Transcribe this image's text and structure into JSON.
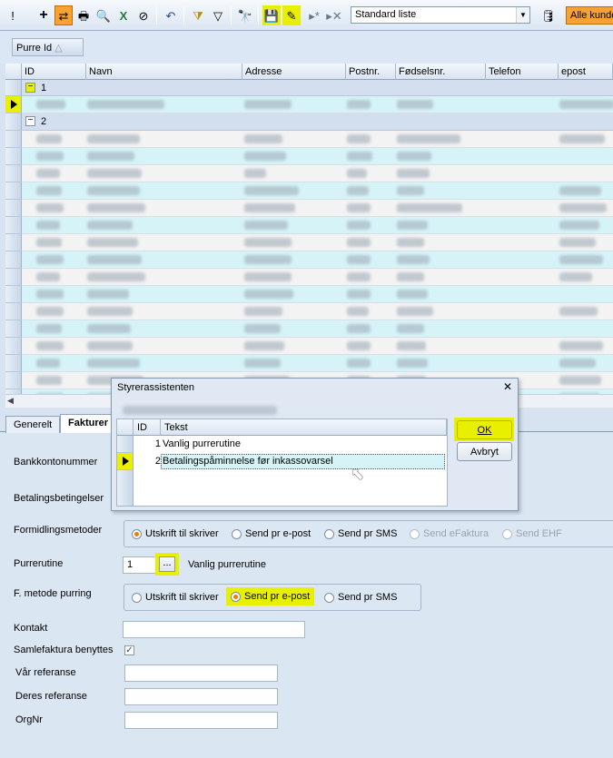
{
  "toolbar": {
    "list_select_value": "Standard liste",
    "alle_kunder_label": "Alle kunde"
  },
  "group_by": {
    "chip_label": "Purre Id"
  },
  "grid": {
    "columns": [
      "ID",
      "Navn",
      "Adresse",
      "Postnr.",
      "Fødselsnr.",
      "Telefon",
      "epost"
    ],
    "groups": [
      {
        "label": "1"
      },
      {
        "label": "2"
      }
    ]
  },
  "tabs": [
    "Generelt",
    "Fakturer"
  ],
  "form": {
    "bankkontonummer_label": "Bankkontonummer",
    "betalingsbetingelser_label": "Betalingsbetingelser",
    "formidlingsmetoder_label": "Formidlingsmetoder",
    "formidlingsmetoder_options": [
      "Utskrift til skriver",
      "Send pr e-post",
      "Send pr SMS",
      "Send eFaktura",
      "Send EHF"
    ],
    "purrerutine_label": "Purrerutine",
    "purrerutine_value": "1",
    "purrerutine_button": "...",
    "purrerutine_name": "Vanlig purrerutine",
    "fmetode_label": "F. metode purring",
    "fmetode_options": [
      "Utskrift til skriver",
      "Send pr e-post",
      "Send pr SMS"
    ],
    "kontakt_label": "Kontakt",
    "samlefaktura_label": "Samlefaktura benyttes",
    "samlefaktura_checked": "✓",
    "var_referanse_label": "Vår referanse",
    "deres_referanse_label": "Deres referanse",
    "orgnr_label": "OrgNr"
  },
  "dialog": {
    "title": "Styrerassistenten",
    "close": "✕",
    "columns": [
      "ID",
      "Tekst"
    ],
    "rows": [
      {
        "id": "1",
        "tekst": "Vanlig purrerutine"
      },
      {
        "id": "2",
        "tekst": "Betalingspåminnelse før inkassovarsel"
      }
    ],
    "ok_label": "OK",
    "cancel_label": "Avbryt"
  },
  "colors": {
    "highlight": "#e8f000",
    "accent_orange": "#f7a232",
    "row_cyan": "#d6f4f8"
  }
}
